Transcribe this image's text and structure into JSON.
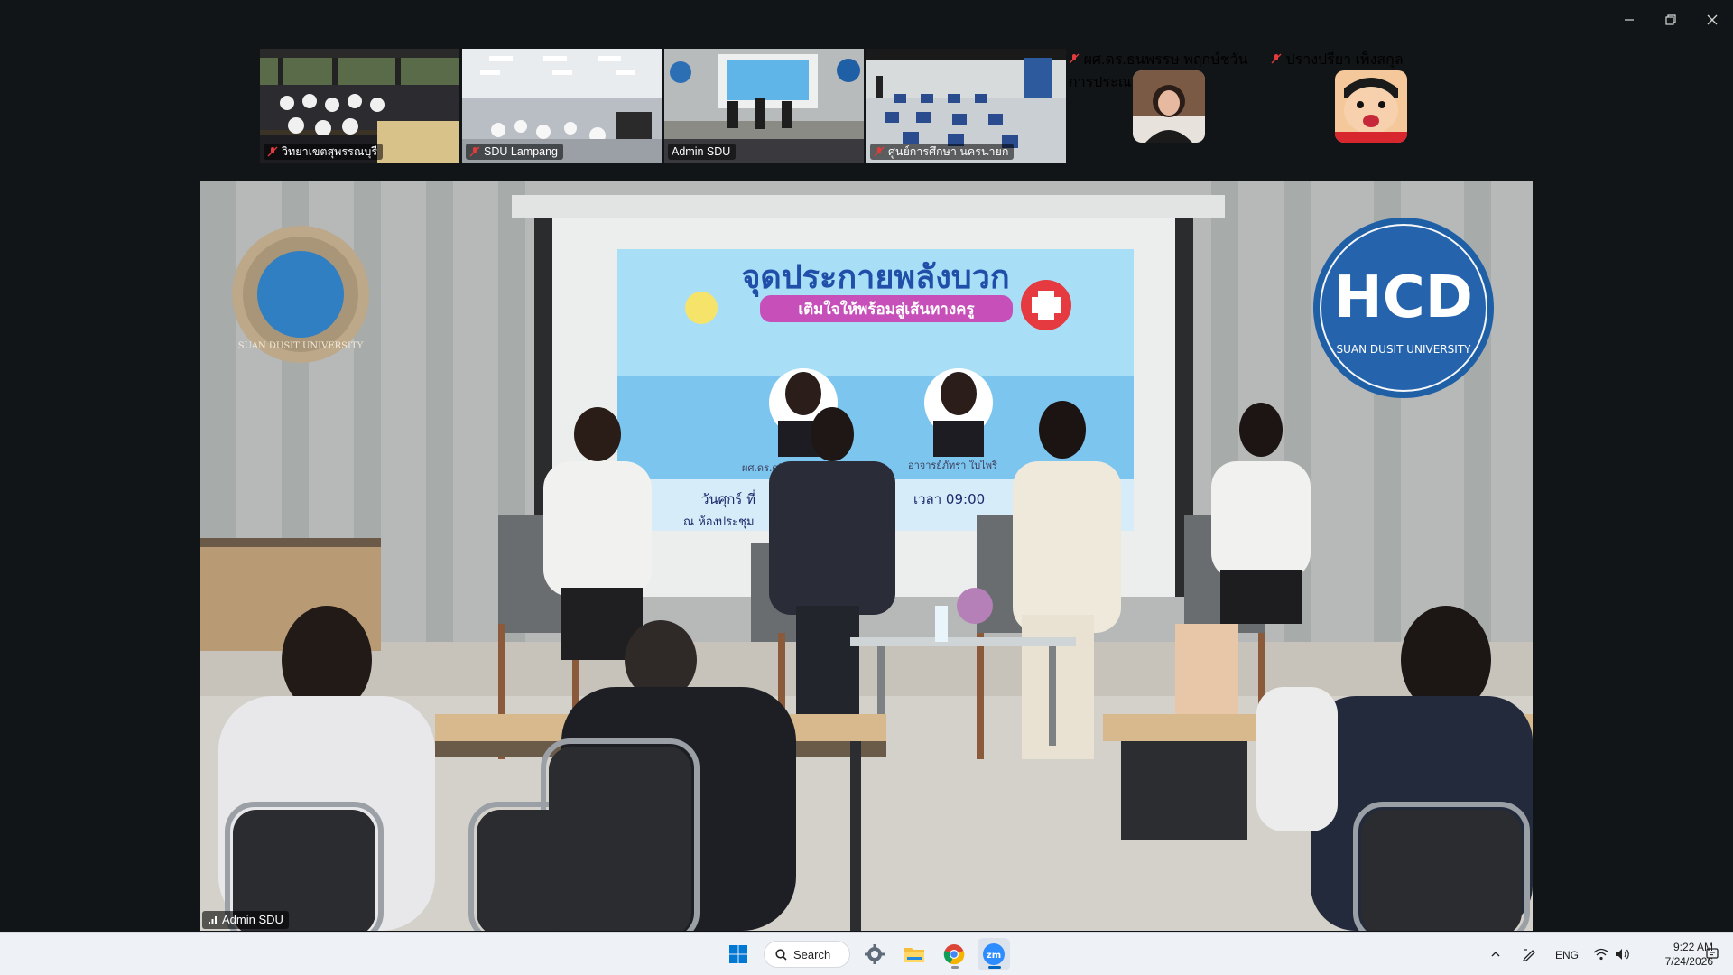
{
  "window": {
    "controls": {
      "minimize_icon": "minimize-icon",
      "restore_icon": "restore-icon",
      "close_icon": "close-icon"
    }
  },
  "participants": [
    {
      "name": "วิทยาเขตสุพรรณบุรี",
      "muted": true
    },
    {
      "name": "SDU Lampang",
      "muted": true
    },
    {
      "name": "Admin SDU",
      "muted": false,
      "active_speaker": true
    },
    {
      "name": "ศูนย์การศึกษา นครนายก",
      "muted": true
    },
    {
      "name": "ผศ.ดร.ธนพรรษ พฤกษ์ชวัน การประณ...",
      "muted": true,
      "video": false
    },
    {
      "name": "ปรางปรียา เพ็งสกุล",
      "muted": true,
      "video": false
    }
  ],
  "main_video": {
    "speaker_name": "Admin SDU",
    "poster_title": "จุดประกายพลังบวก",
    "poster_subtitle": "เติมใจให้พร้อมสู่เส้นทางครู",
    "poster_left_caption": "ผศ.ดร.ศรีแ…",
    "poster_right_caption": "อาจารย์ภัทรา ใบไพรี",
    "poster_date_text": "วันศุกร์ ที่",
    "poster_time_text": "เวลา 09:00",
    "poster_place_text": "ณ ห้องประชุม",
    "left_logo_text": "SUAN DUSIT UNIVERSITY",
    "right_logo_text": "HCD",
    "right_logo_sub": "SUAN DUSIT UNIVERSITY"
  },
  "taskbar": {
    "search_label": "Search",
    "language": "ENG",
    "time": "9:22 AM",
    "date": "7/24/2026",
    "icons": [
      "windows-start-icon",
      "search-icon",
      "settings-icon",
      "file-explorer-icon",
      "chrome-icon",
      "zoom-icon"
    ],
    "colors": {
      "accent": "#0067c0",
      "zoom": "#2d8cff",
      "active_outline": "#23d18b"
    }
  }
}
